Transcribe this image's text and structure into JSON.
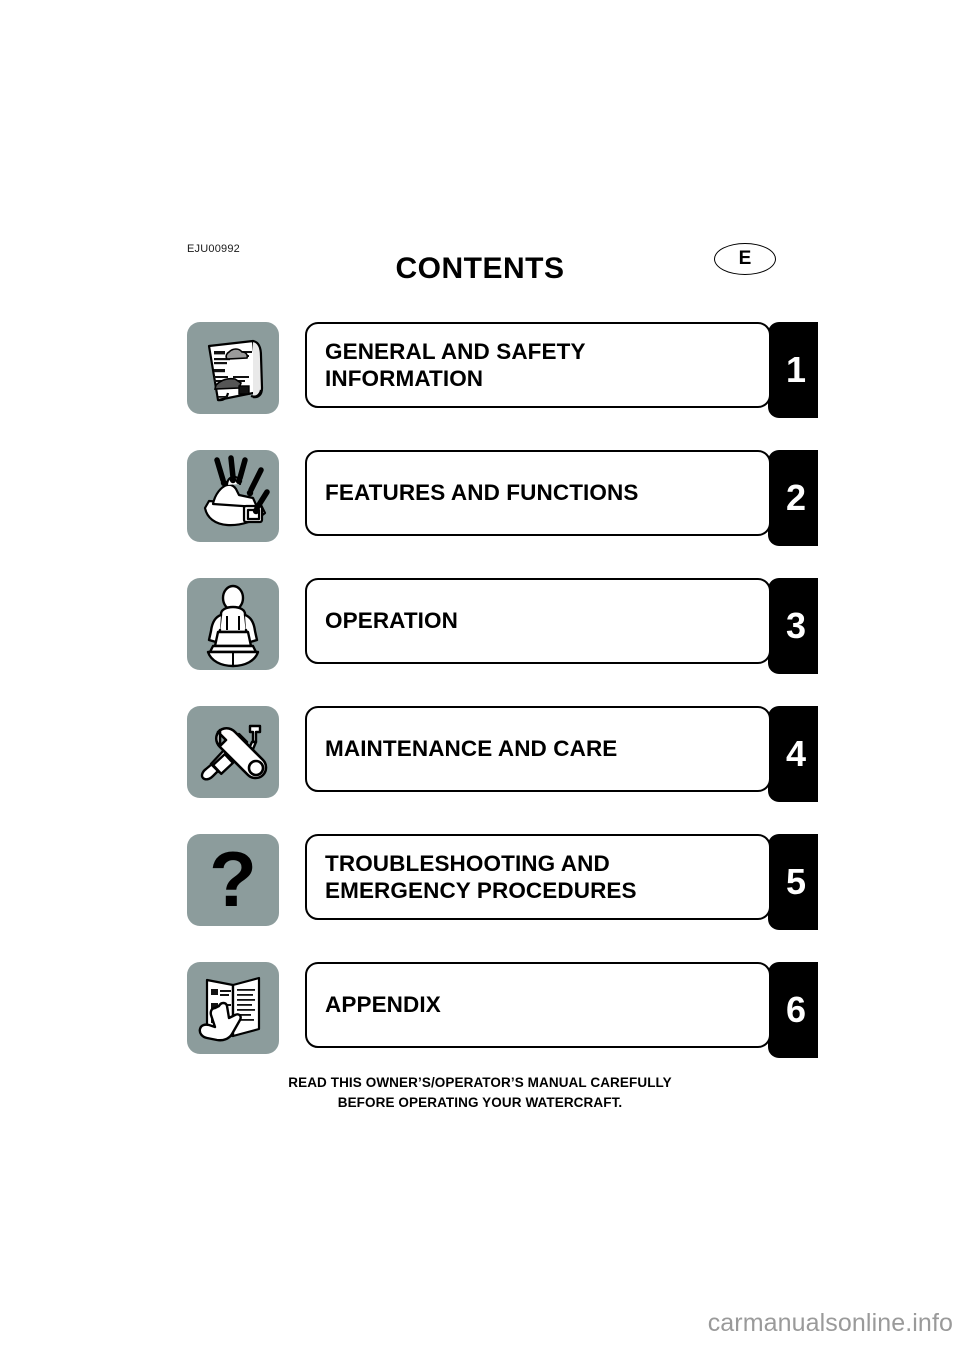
{
  "document": {
    "code": "EJU00992",
    "title": "CONTENTS",
    "language_badge": "E"
  },
  "sections": [
    {
      "number": "1",
      "title": "GENERAL AND SAFETY\nINFORMATION",
      "icon": "rolled-manual-icon"
    },
    {
      "number": "2",
      "title": "FEATURES AND FUNCTIONS",
      "icon": "watercraft-callouts-icon"
    },
    {
      "number": "3",
      "title": "OPERATION",
      "icon": "rider-on-watercraft-icon"
    },
    {
      "number": "4",
      "title": "MAINTENANCE AND CARE",
      "icon": "wrench-grease-gun-icon"
    },
    {
      "number": "5",
      "title": "TROUBLESHOOTING AND\nEMERGENCY PROCEDURES",
      "icon": "question-mark-icon"
    },
    {
      "number": "6",
      "title": "APPENDIX",
      "icon": "open-book-hand-icon"
    }
  ],
  "footer": {
    "note": "READ THIS OWNER’S/OPERATOR’S MANUAL CAREFULLY\nBEFORE OPERATING YOUR WATERCRAFT."
  },
  "watermark": {
    "text": "carmanualsonline.info"
  },
  "colors": {
    "icon_tile_background": "#8c9c9c",
    "tab_background": "#000000",
    "tab_text": "#ffffff",
    "page_background": "#ffffff",
    "watermark_text": "#9a9a9a"
  }
}
